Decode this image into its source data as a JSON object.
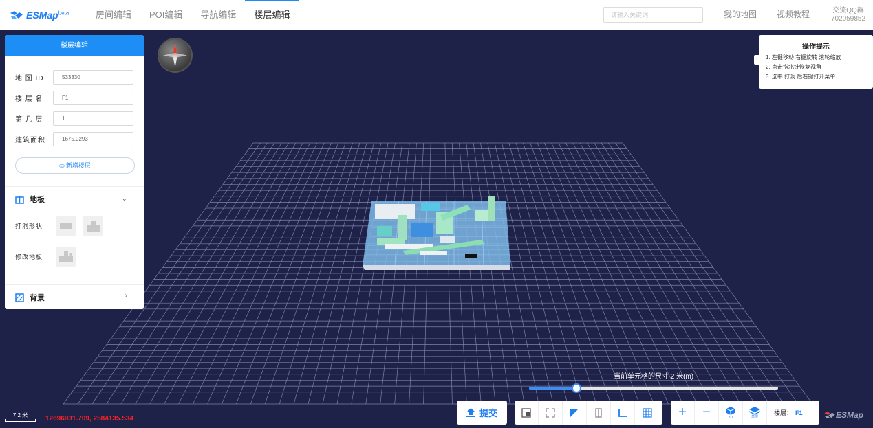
{
  "app": {
    "logo_text": "ESMap",
    "logo_sup": "beta",
    "brand_color": "#1d7ff0"
  },
  "nav": {
    "items": [
      {
        "label": "房间编辑",
        "active": false
      },
      {
        "label": "POI编辑",
        "active": false
      },
      {
        "label": "导航编辑",
        "active": false
      },
      {
        "label": "楼层编辑",
        "active": true
      }
    ]
  },
  "header": {
    "search_placeholder": "请输入关键词",
    "my_map": "我的地图",
    "video_tutorial": "视频教程",
    "qq_group_label": "交流QQ群",
    "qq_group_number": "702059852"
  },
  "panel": {
    "title": "楼层编辑",
    "fields": [
      {
        "label": "地 图 ID",
        "value": "533330"
      },
      {
        "label": "楼 层 名",
        "value": "F1"
      },
      {
        "label": "第 几 层",
        "value": "1"
      },
      {
        "label": "建筑面积",
        "value": "1675.0293"
      }
    ],
    "add_floor_label": "新增楼层",
    "floor_section": {
      "title": "地板",
      "icon": "floor-icon",
      "hole_shape_label": "打洞形状",
      "modify_floor_label": "修改地板"
    },
    "background_section": {
      "title": "背景",
      "icon": "background-icon"
    }
  },
  "tips": {
    "title": "操作提示",
    "items": [
      "1. 左键移动 右键旋转 滚轮缩放",
      "2. 点击指北针恢复视角",
      "3. 选中 打洞 后右键打开菜单"
    ]
  },
  "slider": {
    "label": "当前单元格的尺寸 2 米(m)",
    "fraction": 0.19
  },
  "toolbar": {
    "submit_label": "提交",
    "tools": [
      "import-icon",
      "fit-screen-icon",
      "corner-icon",
      "split-icon",
      "axis-icon",
      "grid-icon"
    ],
    "zoom_in": "+",
    "zoom_out": "−",
    "mode_3d": "3D",
    "mode_single": "单层",
    "floor_label": "楼层：",
    "floor_value": "F1"
  },
  "status": {
    "scale_text": "7.2 米",
    "coordinates": "12696931.709, 2584135.534"
  },
  "footer_logo": "ESMap"
}
